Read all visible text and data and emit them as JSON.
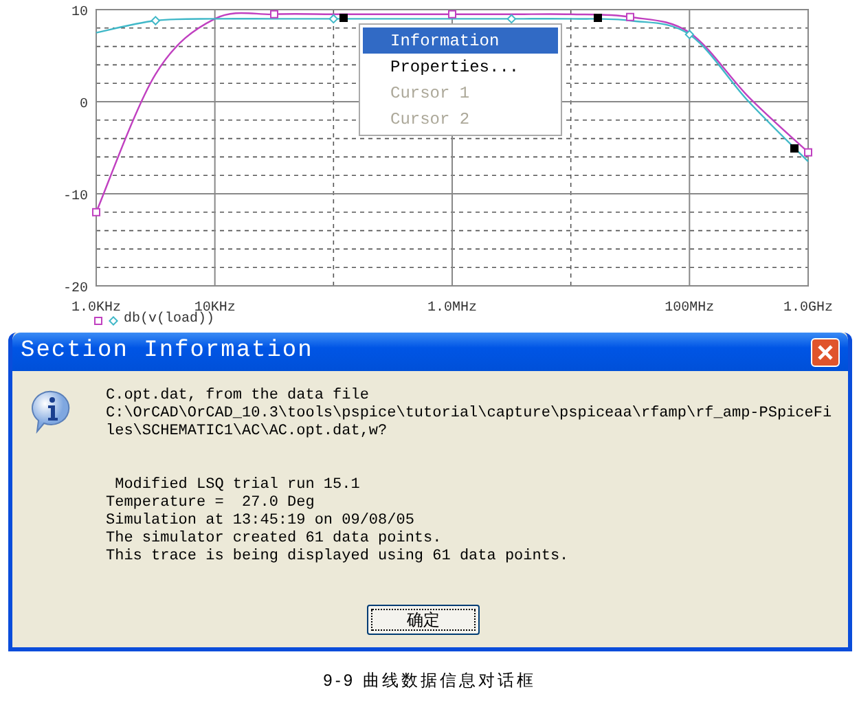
{
  "plot": {
    "chart_data": {
      "type": "line",
      "categories": [
        "1.0KHz",
        null,
        "10KHz",
        null,
        null,
        null,
        "1.0MHz",
        null,
        null,
        null,
        "100MHz",
        null,
        "1.0GHz"
      ],
      "series": [
        {
          "color": "#c040c0",
          "values": [
            -12,
            3,
            9,
            9.5,
            9.5,
            9.5,
            9.5,
            9.5,
            9.5,
            9.2,
            7.5,
            0.5,
            -5.5
          ]
        },
        {
          "color": "#40b8c8",
          "values": [
            7.5,
            8.8,
            9,
            9,
            9,
            9,
            9,
            9,
            9,
            8.8,
            7.3,
            0,
            -6.5
          ]
        }
      ],
      "yticks": [
        -20,
        -10,
        0,
        10
      ],
      "ylim": [
        -20,
        10
      ],
      "grid": true
    },
    "legend": {
      "label": "db(v(load))"
    }
  },
  "context_menu": {
    "items": [
      {
        "label": "Information",
        "selected": true,
        "disabled": false
      },
      {
        "label": "Properties...",
        "selected": false,
        "disabled": false
      },
      {
        "label": "Cursor 1",
        "selected": false,
        "disabled": true
      },
      {
        "label": "Cursor 2",
        "selected": false,
        "disabled": true
      }
    ]
  },
  "dialog": {
    "title": "Section Information",
    "message_paragraphs": [
      [
        "C.opt.dat, from the data file",
        "C:\\OrCAD\\OrCAD_10.3\\tools\\pspice\\tutorial\\capture\\pspiceaa\\rfamp\\rf_amp-PSpiceFi",
        "les\\SCHEMATIC1\\AC\\AC.opt.dat,w?"
      ],
      [
        " Modified LSQ trial run 15.1",
        "Temperature =  27.0 Deg",
        "Simulation at 13:45:19 on 09/08/05",
        "The simulator created 61 data points.",
        "This trace is being displayed using 61 data points."
      ]
    ],
    "button": "确定"
  },
  "caption": "9-9 曲线数据信息对话框"
}
